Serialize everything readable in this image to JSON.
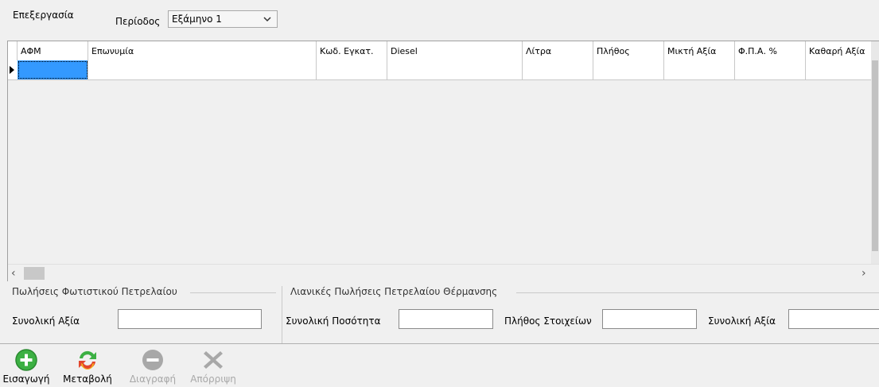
{
  "toolbar_top": {
    "tab_label": "Επεξεργασία",
    "period_label": "Περίοδος",
    "period_value": "Εξάμηνο 1"
  },
  "grid": {
    "columns": [
      "ΑΦΜ",
      "Επωνυμία",
      "Κωδ. Εγκατ.",
      "Diesel",
      "Λίτρα",
      "Πλήθος",
      "Μικτή Αξία",
      "Φ.Π.Α. %",
      "Καθαρή Αξία"
    ],
    "rows": [
      [
        "",
        "",
        "",
        "",
        "",
        "",
        "",
        "",
        ""
      ]
    ]
  },
  "panels": {
    "lighting_oil": {
      "title": "Πωλήσεις Φωτιστικού Πετρελαίου",
      "total_value_label": "Συνολική Αξία",
      "total_value": ""
    },
    "heating_oil_retail": {
      "title": "Λιανικές Πωλήσεις Πετρελαίου Θέρμανσης",
      "total_quantity_label": "Συνολική Ποσότητα",
      "total_quantity": "",
      "item_count_label": "Πλήθος Στοιχείων",
      "item_count": "",
      "total_value_label": "Συνολική Αξία",
      "total_value": ""
    }
  },
  "actions": {
    "insert": {
      "label": "Εισαγωγή",
      "icon": "add-icon",
      "enabled": true
    },
    "edit": {
      "label": "Μεταβολή",
      "icon": "refresh-icon",
      "enabled": true
    },
    "delete": {
      "label": "Διαγραφή",
      "icon": "remove-icon",
      "enabled": false
    },
    "discard": {
      "label": "Απόρριψη",
      "icon": "cancel-icon",
      "enabled": false
    }
  },
  "colors": {
    "selection": "#3399ff",
    "add_green": "#3cb043",
    "edit_red": "#e3462c",
    "disabled_gray": "#a8a8a8"
  }
}
